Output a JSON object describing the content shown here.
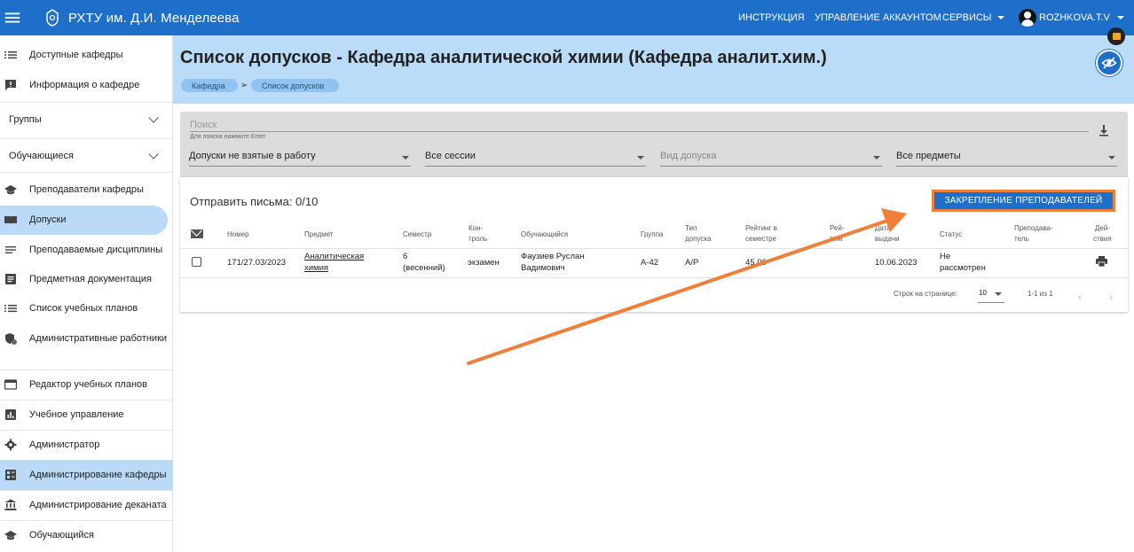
{
  "topbar": {
    "title": "РХТУ им. Д.И. Менделеева",
    "nav": [
      "ИНСТРУКЦИЯ",
      "УПРАВЛЕНИЕ АККАУНТОМ",
      "СЕРВИСЫ"
    ],
    "user": "ROZHKOVA.T.V"
  },
  "sidebar": {
    "top_items": [
      "Доступные кафедры",
      "Информация о кафедре"
    ],
    "groups": [
      "Группы",
      "Обучающиеся"
    ],
    "mid_items": [
      "Преподаватели кафедры",
      "Допуски",
      "Преподаваемые дисциплины",
      "Предметная документация",
      "Список учебных планов",
      "Административные работники"
    ],
    "bottom_items": [
      "Редактор учебных планов",
      "Учебное управление",
      "Администратор",
      "Администрирование кафедры",
      "Администрирование деканата",
      "Обучающийся"
    ],
    "active_item": "Допуски",
    "highlight_item": "Администрирование кафедры"
  },
  "header": {
    "title": "Список допусков - Кафедра аналитической химии (Кафедра аналит.хим.)",
    "breadcrumbs": [
      "Кафедра",
      "Список допусков"
    ]
  },
  "filters": {
    "search_label": "Поиск",
    "search_hint": "Для поиска нажмите Enter",
    "selects": [
      "Допуски не взятые в работу",
      "Все сессии",
      "Вид допуска",
      "Все предметы"
    ]
  },
  "table": {
    "send_letters": "Отправить письма: 0/10",
    "assign_button": "ЗАКРЕПЛЕНИЕ ПРЕПОДАВАТЕЛЕЙ",
    "headers": {
      "number": "Номер",
      "subject": "Предмет",
      "semester": "Семестр",
      "control_1": "Кон-",
      "control_2": "троль",
      "student": "Обучающийся",
      "group": "Группа",
      "type_1": "Тип",
      "type_2": "допуска",
      "rating_sem_1": "Рейтинг в",
      "rating_sem_2": "семестре",
      "rating_1": "Рей-",
      "rating_2": "тинг",
      "date_1": "Дата",
      "date_2": "выдачи",
      "status": "Статус",
      "teacher_1": "Преподава-",
      "teacher_2": "тель",
      "actions_1": "Дей-",
      "actions_2": "ствия"
    },
    "rows": [
      {
        "number": "171/27.03/2023",
        "subject_1": "Аналитическая",
        "subject_2": "химия",
        "semester_1": "6",
        "semester_2": "(весенний)",
        "control": "экзамен",
        "student_1": "Фаузиев Руслан",
        "student_2": "Вадимович",
        "group": "А-42",
        "type": "А/Р",
        "rating_sem": "45,00",
        "rating": "",
        "date": "10.06.2023",
        "status_1": "Не",
        "status_2": "рассмотрен",
        "teacher": ""
      }
    ],
    "pager": {
      "rows_label": "Строк на странице:",
      "rows_value": "10",
      "range": "1-1 из 1"
    }
  },
  "colors": {
    "primary": "#1e6fc9",
    "header_band": "#bbdcf8",
    "annotation_arrow": "#f07f3a"
  }
}
